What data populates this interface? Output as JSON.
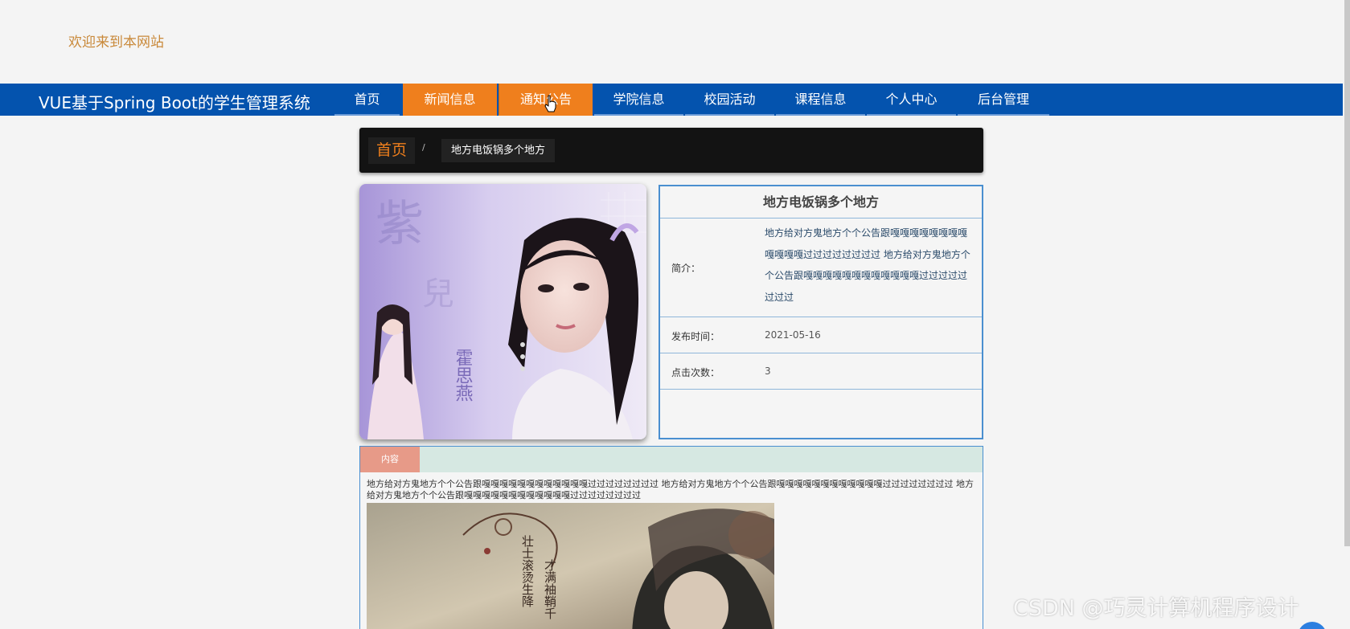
{
  "header": {
    "welcome": "欢迎来到本网站"
  },
  "navbar": {
    "site_title": "VUE基于Spring Boot的学生管理系统",
    "items": [
      {
        "label": "首页",
        "active": false
      },
      {
        "label": "新闻信息",
        "active": true
      },
      {
        "label": "通知公告",
        "active": true
      },
      {
        "label": "学院信息",
        "active": false
      },
      {
        "label": "校园活动",
        "active": false
      },
      {
        "label": "课程信息",
        "active": false
      },
      {
        "label": "个人中心",
        "active": false
      },
      {
        "label": "后台管理",
        "active": false
      }
    ]
  },
  "breadcrumb": {
    "home": "首页",
    "separator": "/",
    "current": "地方电饭锅多个地方"
  },
  "photo": {
    "caption_text": "霍思燕"
  },
  "detail": {
    "title": "地方电饭锅多个地方",
    "summary_label": "简介：",
    "summary_value": "地方给对方鬼地方个个公告跟嘎嘎嘎嘎嘎嘎嘎嘎嘎嘎嘎嘎过过过过过过过过 地方给对方鬼地方个个公告跟嘎嘎嘎嘎嘎嘎嘎嘎嘎嘎嘎嘎过过过过过过过过",
    "publish_label": "发布时间：",
    "publish_value": "2021-05-16",
    "clicks_label": "点击次数：",
    "clicks_value": "3"
  },
  "content": {
    "tab_label": "内容",
    "text": "地方给对方鬼地方个个公告跟嘎嘎嘎嘎嘎嘎嘎嘎嘎嘎嘎嘎过过过过过过过过 地方给对方鬼地方个个公告跟嘎嘎嘎嘎嘎嘎嘎嘎嘎嘎嘎嘎过过过过过过过过 地方给对方鬼地方个个公告跟嘎嘎嘎嘎嘎嘎嘎嘎嘎嘎嘎嘎过过过过过过过过"
  },
  "watermark": "CSDN @巧灵计算机程序设计",
  "colors": {
    "nav_bg": "#0453ae",
    "accent": "#ef7f1d",
    "breadcrumb_bg": "#131313",
    "panel_border": "#4a8fd0",
    "welcome_text": "#c9893a",
    "tab_active": "#e79a88"
  }
}
